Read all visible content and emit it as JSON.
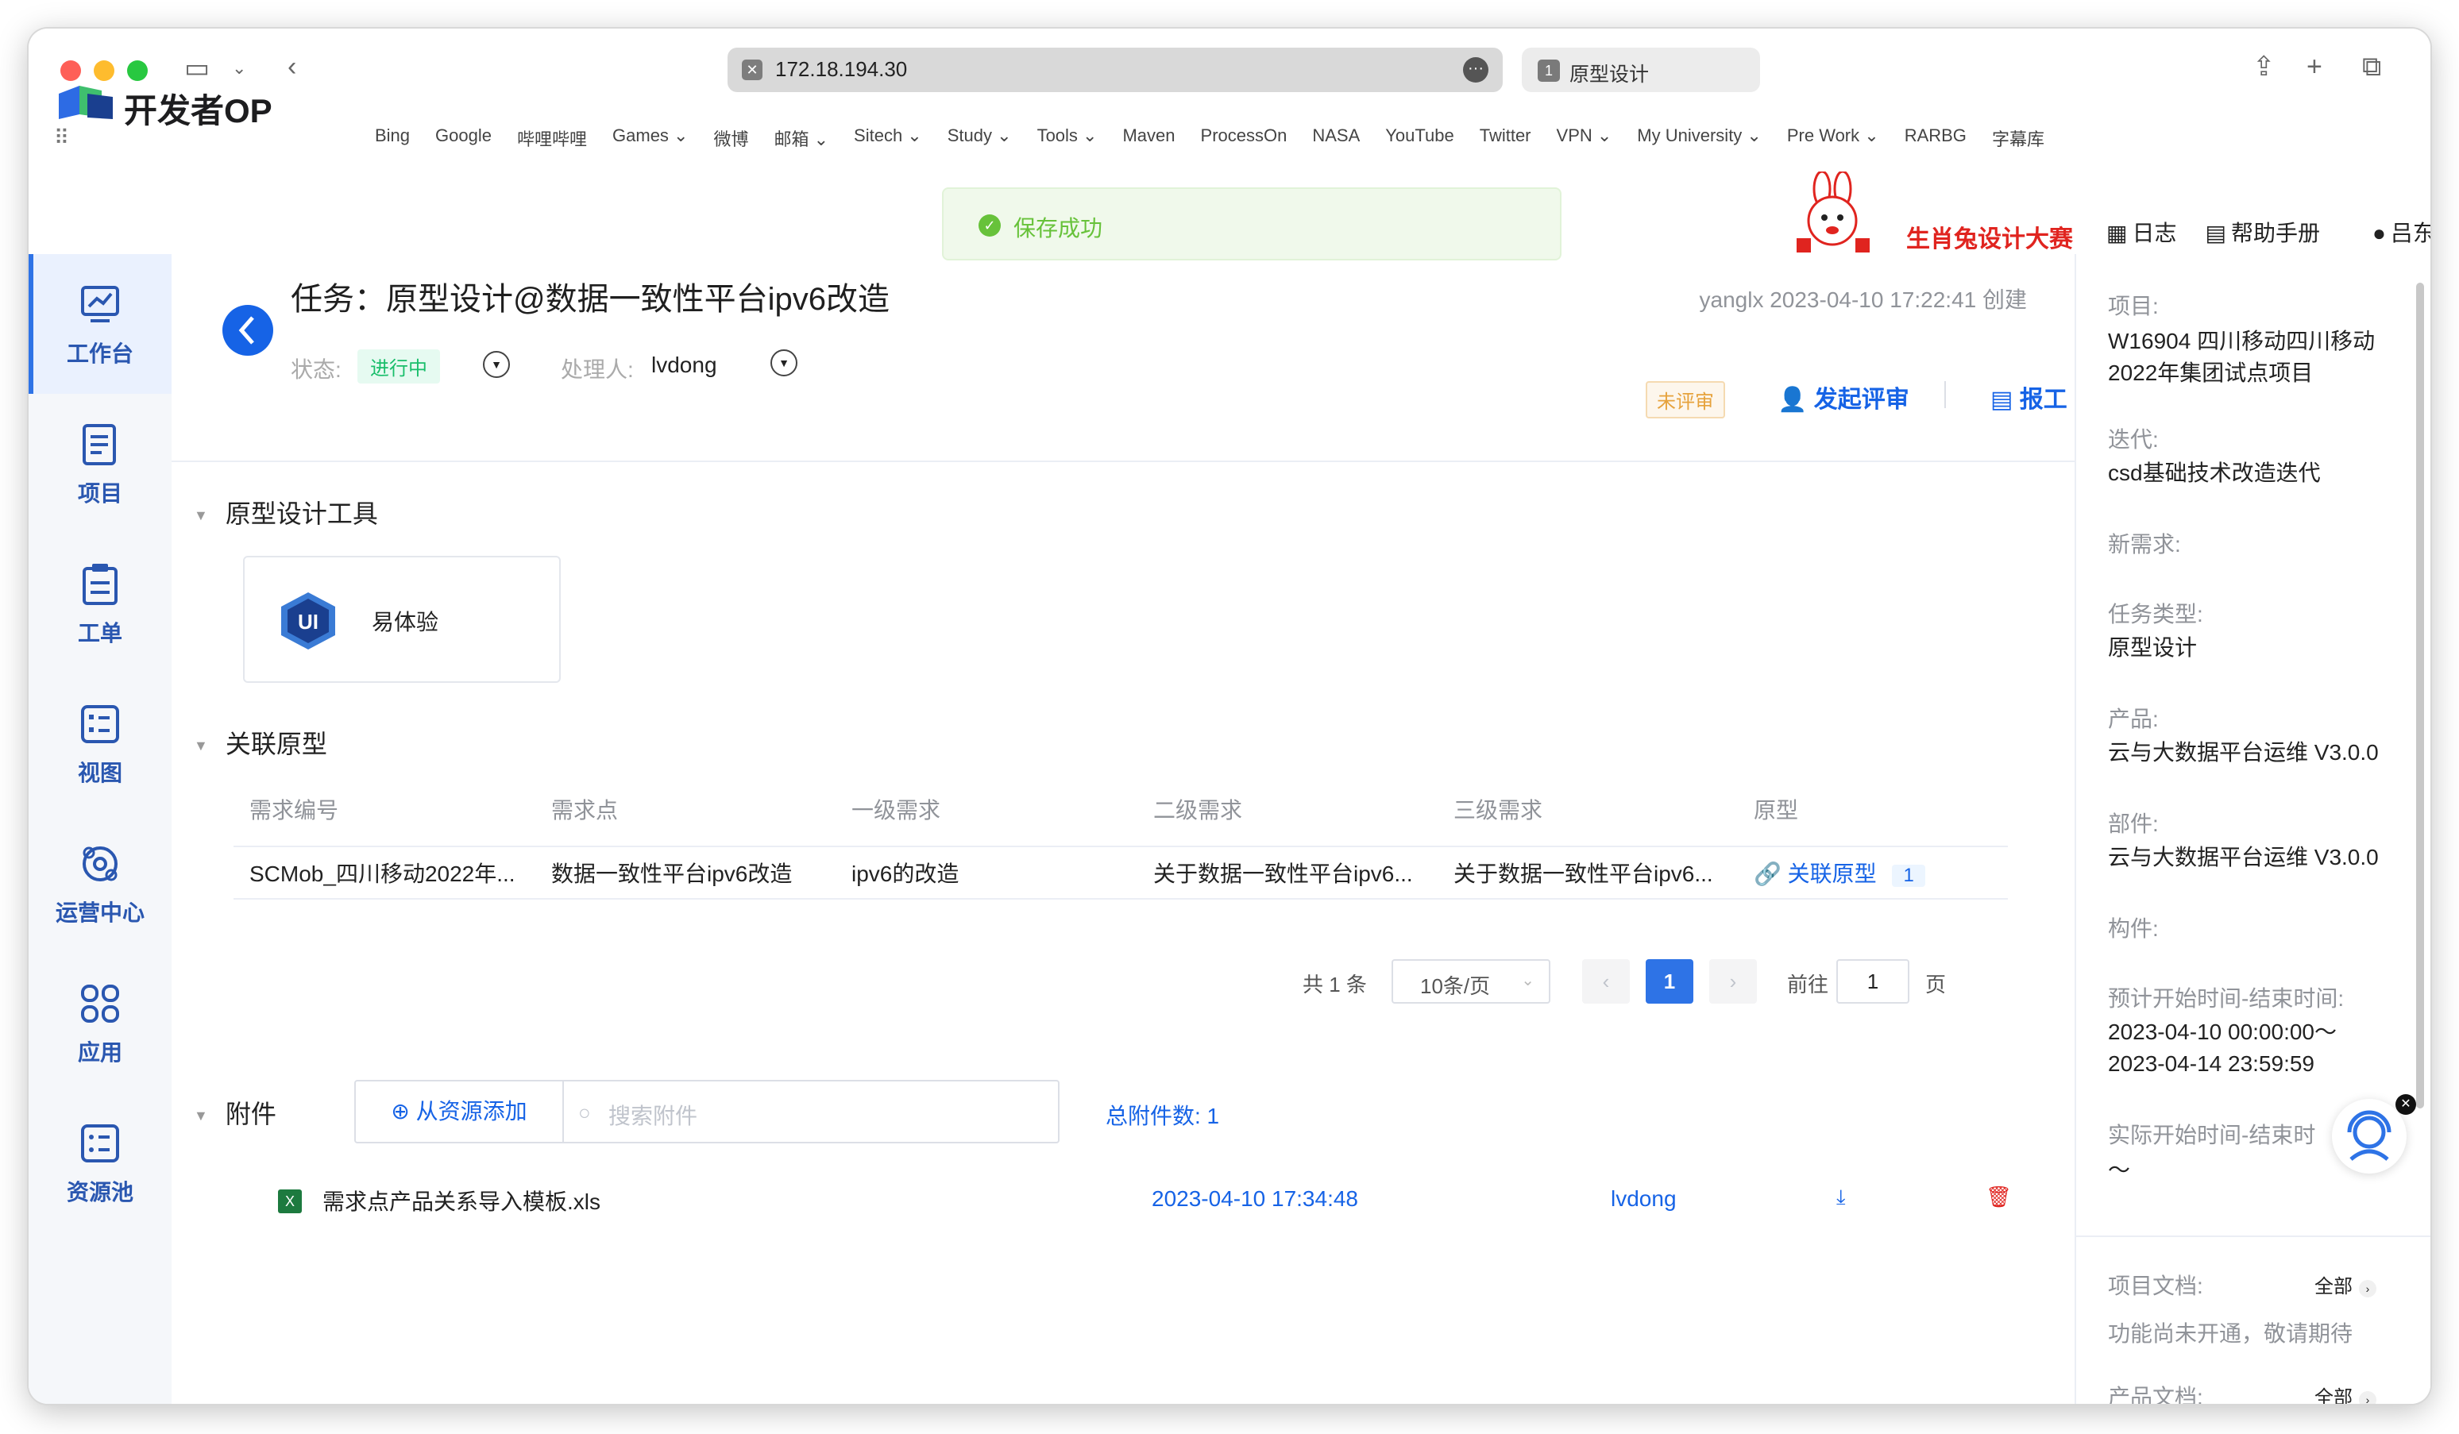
{
  "browser": {
    "url": "172.18.194.30",
    "tab": {
      "number": "1",
      "title": "原型设计"
    },
    "bookmarks": [
      "Bing",
      "Google",
      "哔哩哔哩",
      "Games ⌄",
      "微博",
      "邮箱 ⌄",
      "Sitech ⌄",
      "Study ⌄",
      "Tools ⌄",
      "Maven",
      "ProcessOn",
      "NASA",
      "YouTube",
      "Twitter",
      "VPN ⌄",
      "My University ⌄",
      "Pre Work ⌄",
      "RARBG",
      "字幕库"
    ]
  },
  "header": {
    "logo_text": "开发者OP",
    "toast": "保存成功",
    "promo": "生肖兔设计大赛",
    "links": {
      "log": "日志",
      "help": "帮助手册",
      "user": "吕东"
    }
  },
  "sidebar": {
    "items": [
      {
        "label": "工作台"
      },
      {
        "label": "项目"
      },
      {
        "label": "工单"
      },
      {
        "label": "视图"
      },
      {
        "label": "运营中心"
      },
      {
        "label": "应用"
      },
      {
        "label": "资源池"
      }
    ]
  },
  "task": {
    "title": "任务：原型设计@数据一致性平台ipv6改造",
    "creator": "yanglx 2023-04-10 17:22:41 创建",
    "status_label": "状态:",
    "status_value": "进行中",
    "handler_label": "处理人:",
    "handler_value": "lvdong",
    "review_badge": "未评审",
    "start_review": "发起评审",
    "report": "报工"
  },
  "sections": {
    "tools": "原型设计工具",
    "tool_name": "易体验",
    "linked": "关联原型",
    "attachments": "附件"
  },
  "table": {
    "headers": [
      "需求编号",
      "需求点",
      "一级需求",
      "二级需求",
      "三级需求",
      "原型"
    ],
    "row": {
      "req_id": "SCMob_四川移动2022年...",
      "req_point": "数据一致性平台ipv6改造",
      "level1": "ipv6的改造",
      "level2": "关于数据一致性平台ipv6...",
      "level3": "关于数据一致性平台ipv6...",
      "proto_link": "关联原型",
      "proto_count": "1"
    }
  },
  "pager": {
    "total": "共 1 条",
    "size": "10条/页",
    "current": "1",
    "goto": "前往",
    "input": "1",
    "unit": "页"
  },
  "attach": {
    "add": "从资源添加",
    "search_placeholder": "搜索附件",
    "total": "总附件数:  1",
    "file": {
      "name": "需求点产品关系导入模板.xls",
      "date": "2023-04-10 17:34:48",
      "user": "lvdong"
    }
  },
  "right_panel": {
    "project_label": "项目:",
    "project_value": "W16904 四川移动四川移动2022年集团试点项目",
    "iteration_label": "迭代:",
    "iteration_value": "csd基础技术改造迭代",
    "new_req_label": "新需求:",
    "task_type_label": "任务类型:",
    "task_type_value": "原型设计",
    "product_label": "产品:",
    "product_value": "云与大数据平台运维 V3.0.0",
    "part_label": "部件:",
    "part_value": "云与大数据平台运维 V3.0.0",
    "component_label": "构件:",
    "plan_time_label": "预计开始时间-结束时间:",
    "plan_time_value": "2023-04-10 00:00:00～ 2023-04-14 23:59:59",
    "actual_time_label": "实际开始时间-结束时",
    "actual_time_value": "～",
    "proj_doc_label": "项目文档:",
    "proj_doc_all": "全部",
    "proj_doc_note": "功能尚未开通，敬请期待",
    "prod_doc_label": "产品文档:",
    "prod_doc_all": "全部"
  },
  "colors": {
    "accent": "#1663e6",
    "success": "#67c23a",
    "danger": "#e0241f",
    "warning": "#e6a23c"
  }
}
